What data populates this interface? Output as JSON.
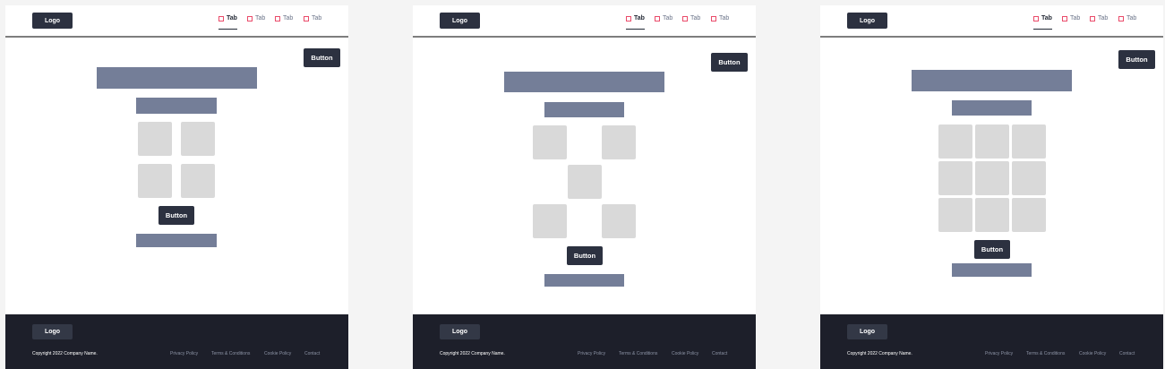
{
  "colors": {
    "page_bg": "#f4f4f4",
    "frame_bg": "#ffffff",
    "dark": "#2c3140",
    "footer_bg": "#1d1f2a",
    "bar": "#747e98",
    "tile": "#d9d9d9",
    "tab_icon": "#ea4b6a"
  },
  "header": {
    "logo": "Logo",
    "tabs": [
      {
        "label": "Tab",
        "icon": "dashed-square-icon",
        "active": true
      },
      {
        "label": "Tab",
        "icon": "dashed-square-icon",
        "active": false
      },
      {
        "label": "Tab",
        "icon": "dashed-square-icon",
        "active": false
      },
      {
        "label": "Tab",
        "icon": "dashed-square-icon",
        "active": false
      }
    ]
  },
  "main": {
    "corner_button": "Button",
    "center_button": "Button"
  },
  "footer": {
    "logo": "Logo",
    "copyright": "Copyright 2022 Company Name.",
    "links": [
      "Privacy Policy",
      "Terms & Conditions",
      "Cookie Policy",
      "Contact"
    ]
  },
  "variants": [
    {
      "layout": "2x2 grid",
      "tile_count": 4
    },
    {
      "layout": "dice five",
      "tile_count": 5
    },
    {
      "layout": "3x3 grid",
      "tile_count": 9
    }
  ]
}
